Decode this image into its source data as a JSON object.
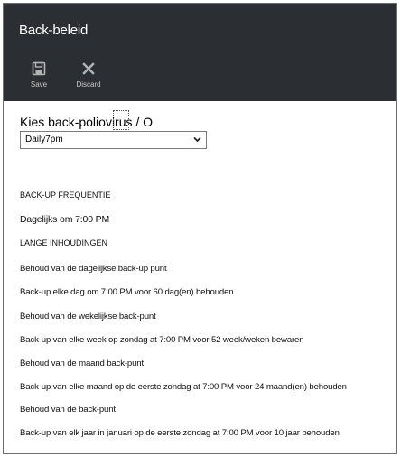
{
  "blade": {
    "title": "Back-beleid"
  },
  "toolbar": {
    "save_label": "Save",
    "discard_label": "Discard"
  },
  "policy_select": {
    "label": "Kies back-poliovirus / O",
    "value": "Daily7pm"
  },
  "frequency": {
    "heading": "BACK-UP FREQUENTIE",
    "value": "Dagelijks om 7:00 PM"
  },
  "retention": {
    "heading": "LANGE INHOUDINGEN",
    "daily_label": "Behoud van de dagelijkse back-up punt",
    "daily_value": "Back-up elke dag om 7:00 PM voor 60 dag(en) behouden",
    "weekly_label": "Behoud van de wekelijkse back-punt",
    "weekly_value": "Back-up van elke week op zondag at 7:00 PM voor 52 week/weken bewaren",
    "monthly_label": "Behoud van de maand back-punt",
    "monthly_value": "Back-up van elke maand op de eerste zondag at 7:00 PM voor 24 maand(en) behouden",
    "yearly_label": "Behoud van de back-punt",
    "yearly_value": "Back-up van elk jaar in januari op de eerste zondag at 7:00 PM voor 10 jaar behouden"
  },
  "colors": {
    "header_bg": "#2b2f34",
    "header_text": "#ffffff",
    "command_icon": "#b4b4b4"
  }
}
